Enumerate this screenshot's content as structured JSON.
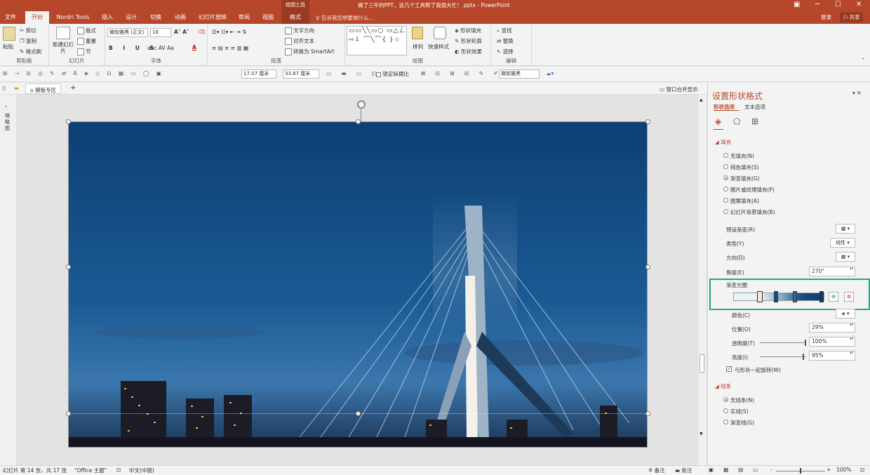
{
  "titlebar": {
    "context_label": "绘图工具",
    "title": "做了三年的PPT，这几个工具帮了我很大忙！.pptx - PowerPoint"
  },
  "tabs": [
    {
      "label": "文件"
    },
    {
      "label": "开始",
      "active": true
    },
    {
      "label": "Nordri Tools"
    },
    {
      "label": "插入"
    },
    {
      "label": "设计"
    },
    {
      "label": "切换"
    },
    {
      "label": "动画"
    },
    {
      "label": "幻灯片放映"
    },
    {
      "label": "审阅"
    },
    {
      "label": "视图"
    },
    {
      "label": "格式"
    }
  ],
  "tellme": "告诉我您想要做什么...",
  "login": "登录",
  "share": "共享",
  "ribbon": {
    "clipboard": {
      "paste": "粘贴",
      "cut": "剪切",
      "copy": "复制",
      "format_painter": "格式刷",
      "label": "剪贴板"
    },
    "slides": {
      "new_slide": "新建幻灯片",
      "layout": "版式",
      "reset": "重置",
      "section": "节",
      "label": "幻灯片"
    },
    "font": {
      "font_name": "微软雅黑 (正文)",
      "font_size": "18",
      "label": "字体"
    },
    "paragraph": {
      "text_direction": "文字方向",
      "align_text": "对齐文本",
      "smartart": "转换为 SmartArt",
      "label": "段落"
    },
    "drawing": {
      "arrange": "排列",
      "quick_styles": "快速样式",
      "shape_fill": "形状填充",
      "shape_outline": "形状轮廓",
      "shape_effects": "形状效果",
      "label": "绘图"
    },
    "editing": {
      "find": "查找",
      "replace": "替换",
      "select": "选择",
      "label": "编辑"
    }
  },
  "qat": {
    "width_value": "17.07 厘米",
    "height_value": "33.87 厘米",
    "lock_ratio": "锁定纵横比",
    "font_name": "微软雅黑"
  },
  "doc_tabs": {
    "template_zone": "模板专区",
    "merge_window": "窗口合并显示"
  },
  "left_rail": {
    "label": "缩略图"
  },
  "pane": {
    "title": "设置形状格式",
    "tab_shape": "形状选项",
    "tab_text": "文本选项",
    "fill_section": "填充",
    "fill_options": [
      {
        "label": "无填充(N)",
        "checked": false
      },
      {
        "label": "纯色填充(S)",
        "checked": false
      },
      {
        "label": "渐变填充(G)",
        "checked": true
      },
      {
        "label": "图片或纹理填充(P)",
        "checked": false
      },
      {
        "label": "图案填充(A)",
        "checked": false
      },
      {
        "label": "幻灯片背景填充(B)",
        "checked": false
      }
    ],
    "preset_gradient": "预设渐变(R)",
    "type_label": "类型(Y)",
    "type_value": "线性",
    "direction_label": "方向(D)",
    "angle_label": "角度(E)",
    "angle_value": "270°",
    "stops_label": "渐变光圈",
    "color_label": "颜色(C)",
    "position_label": "位置(O)",
    "position_value": "29%",
    "transparency_label": "透明度(T)",
    "transparency_value": "100%",
    "brightness_label": "亮度(I)",
    "brightness_value": "95%",
    "rotate_with_shape": "与形状一起旋转(W)",
    "line_section": "线条",
    "line_options": [
      {
        "label": "无线条(N)",
        "checked": true
      },
      {
        "label": "实线(S)",
        "checked": false
      },
      {
        "label": "渐变线(G)",
        "checked": false
      }
    ],
    "colors": {
      "accent": "#b7472a",
      "highlight_box": "#2aa37e"
    }
  },
  "status": {
    "slide_info": "幻灯片 第 14 张，共 17 张",
    "theme": "\"Office 主题\"",
    "language": "中文(中国)",
    "notes": "备注",
    "comments": "批注",
    "zoom": "100%"
  }
}
